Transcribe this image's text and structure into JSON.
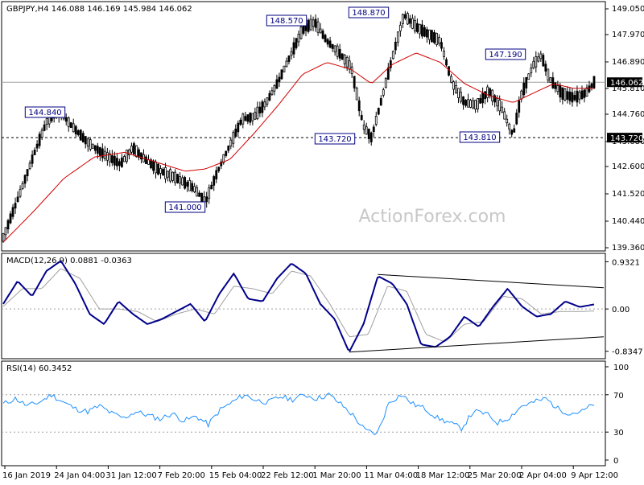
{
  "chart_data": [
    {
      "type": "candlestick",
      "header": "GBPJPY,H4  146.088 146.169 145.984 146.062",
      "symbol": "GBPJPY",
      "timeframe": "H4",
      "ohlc_readout": {
        "open": 146.088,
        "high": 146.169,
        "low": 145.984,
        "close": 146.062
      },
      "watermark": "ActionForex.com",
      "ylim": [
        139.0,
        149.4
      ],
      "y_ticks": [
        "149.050",
        "147.970",
        "146.890",
        "145.810",
        "144.760",
        "143.680",
        "142.600",
        "141.520",
        "140.440",
        "139.360"
      ],
      "current_price": "146.062",
      "support_level": {
        "value": 143.72,
        "label": "143.720"
      },
      "moving_average_color": "#d00000",
      "candle_color": "#000000",
      "price_path": [
        [
          0,
          139.5
        ],
        [
          8,
          141.3
        ],
        [
          16,
          143.2
        ],
        [
          22,
          144.5
        ],
        [
          28,
          144.8
        ],
        [
          34,
          144.2
        ],
        [
          42,
          143.5
        ],
        [
          50,
          143.0
        ],
        [
          58,
          142.6
        ],
        [
          64,
          143.3
        ],
        [
          70,
          142.8
        ],
        [
          78,
          142.3
        ],
        [
          86,
          142.0
        ],
        [
          94,
          141.6
        ],
        [
          100,
          141.0
        ],
        [
          106,
          142.3
        ],
        [
          112,
          143.4
        ],
        [
          118,
          144.5
        ],
        [
          124,
          144.6
        ],
        [
          130,
          145.2
        ],
        [
          136,
          146.1
        ],
        [
          142,
          147.2
        ],
        [
          148,
          148.3
        ],
        [
          154,
          148.6
        ],
        [
          160,
          147.8
        ],
        [
          166,
          147.3
        ],
        [
          172,
          146.7
        ],
        [
          178,
          144.2
        ],
        [
          182,
          143.72
        ],
        [
          186,
          145.0
        ],
        [
          192,
          147.0
        ],
        [
          198,
          148.9
        ],
        [
          204,
          148.4
        ],
        [
          210,
          148.1
        ],
        [
          216,
          147.8
        ],
        [
          222,
          146.0
        ],
        [
          228,
          145.2
        ],
        [
          234,
          145.1
        ],
        [
          240,
          145.7
        ],
        [
          246,
          145.0
        ],
        [
          252,
          143.81
        ],
        [
          256,
          145.5
        ],
        [
          262,
          146.8
        ],
        [
          266,
          147.19
        ],
        [
          270,
          146.2
        ],
        [
          276,
          145.6
        ],
        [
          282,
          145.4
        ],
        [
          288,
          145.6
        ],
        [
          292,
          146.06
        ]
      ],
      "ma_path": [
        [
          0,
          139.3
        ],
        [
          15,
          140.6
        ],
        [
          30,
          142.0
        ],
        [
          45,
          142.9
        ],
        [
          60,
          143.1
        ],
        [
          75,
          142.7
        ],
        [
          90,
          142.3
        ],
        [
          100,
          142.4
        ],
        [
          112,
          142.8
        ],
        [
          124,
          143.9
        ],
        [
          136,
          145.1
        ],
        [
          148,
          146.4
        ],
        [
          160,
          146.9
        ],
        [
          172,
          146.6
        ],
        [
          182,
          146.0
        ],
        [
          192,
          146.8
        ],
        [
          204,
          147.3
        ],
        [
          216,
          146.9
        ],
        [
          228,
          146.0
        ],
        [
          240,
          145.5
        ],
        [
          252,
          145.2
        ],
        [
          262,
          145.6
        ],
        [
          272,
          146.0
        ],
        [
          282,
          145.8
        ],
        [
          292,
          145.8
        ]
      ],
      "annotations": [
        {
          "text": "144.840",
          "value": 144.84
        },
        {
          "text": "141.000",
          "value": 141.0
        },
        {
          "text": "148.570",
          "value": 148.57
        },
        {
          "text": "143.720",
          "value": 143.72
        },
        {
          "text": "148.870",
          "value": 148.87
        },
        {
          "text": "143.810",
          "value": 143.81
        },
        {
          "text": "147.190",
          "value": 147.19
        }
      ]
    },
    {
      "type": "line",
      "header": "MACD(12,26,9) 0.0881 -0.0363",
      "indicator": "MACD(12,26,9)",
      "values_readout": {
        "macd": 0.0881,
        "signal": -0.0363
      },
      "ylim": [
        -0.95,
        1.05
      ],
      "y_ticks": [
        "0.9321",
        "0.00",
        "-0.8347"
      ],
      "macd_color": "#00008b",
      "signal_color": "#a0a0a0",
      "zero_line": 0.0,
      "macd_path": [
        [
          0,
          0.1
        ],
        [
          6,
          0.55
        ],
        [
          12,
          0.25
        ],
        [
          18,
          0.75
        ],
        [
          24,
          0.95
        ],
        [
          30,
          0.5
        ],
        [
          36,
          -0.1
        ],
        [
          42,
          -0.3
        ],
        [
          48,
          0.15
        ],
        [
          54,
          -0.1
        ],
        [
          60,
          -0.3
        ],
        [
          66,
          -0.2
        ],
        [
          72,
          -0.05
        ],
        [
          78,
          0.1
        ],
        [
          84,
          -0.25
        ],
        [
          90,
          0.3
        ],
        [
          96,
          0.7
        ],
        [
          102,
          0.2
        ],
        [
          108,
          0.15
        ],
        [
          114,
          0.6
        ],
        [
          120,
          0.9
        ],
        [
          126,
          0.7
        ],
        [
          132,
          0.1
        ],
        [
          138,
          -0.2
        ],
        [
          144,
          -0.85
        ],
        [
          150,
          -0.3
        ],
        [
          156,
          0.65
        ],
        [
          162,
          0.5
        ],
        [
          168,
          0.1
        ],
        [
          174,
          -0.7
        ],
        [
          180,
          -0.75
        ],
        [
          186,
          -0.55
        ],
        [
          192,
          -0.15
        ],
        [
          198,
          -0.35
        ],
        [
          204,
          0.05
        ],
        [
          210,
          0.4
        ],
        [
          216,
          0.05
        ],
        [
          222,
          -0.15
        ],
        [
          228,
          -0.1
        ],
        [
          234,
          0.15
        ],
        [
          240,
          0.04
        ],
        [
          246,
          0.09
        ]
      ],
      "signal_path": [
        [
          0,
          0.05
        ],
        [
          8,
          0.4
        ],
        [
          16,
          0.4
        ],
        [
          24,
          0.8
        ],
        [
          32,
          0.6
        ],
        [
          40,
          0.0
        ],
        [
          48,
          0.0
        ],
        [
          56,
          -0.05
        ],
        [
          64,
          -0.25
        ],
        [
          72,
          -0.1
        ],
        [
          80,
          0.0
        ],
        [
          88,
          -0.1
        ],
        [
          96,
          0.45
        ],
        [
          104,
          0.4
        ],
        [
          112,
          0.3
        ],
        [
          120,
          0.75
        ],
        [
          128,
          0.65
        ],
        [
          136,
          0.1
        ],
        [
          144,
          -0.55
        ],
        [
          152,
          -0.5
        ],
        [
          160,
          0.45
        ],
        [
          168,
          0.35
        ],
        [
          176,
          -0.5
        ],
        [
          184,
          -0.65
        ],
        [
          192,
          -0.3
        ],
        [
          200,
          -0.25
        ],
        [
          208,
          0.25
        ],
        [
          216,
          0.2
        ],
        [
          224,
          -0.1
        ],
        [
          232,
          -0.05
        ],
        [
          240,
          -0.05
        ],
        [
          246,
          -0.04
        ]
      ],
      "trend_lines": [
        {
          "from": [
            156,
            0.68
          ],
          "to": [
            246,
            0.42
          ]
        },
        {
          "from": [
            144,
            -0.85
          ],
          "to": [
            246,
            -0.55
          ]
        }
      ]
    },
    {
      "type": "line",
      "header": "RSI(14) 60.3452",
      "indicator": "RSI(14)",
      "value_readout": 60.3452,
      "ylim": [
        0,
        100
      ],
      "y_ticks": [
        "100",
        "70",
        "30",
        "0"
      ],
      "levels": [
        70,
        30
      ],
      "rsi_color": "#1e90ff",
      "rsi_path": [
        [
          0,
          60
        ],
        [
          6,
          66
        ],
        [
          12,
          58
        ],
        [
          18,
          62
        ],
        [
          24,
          70
        ],
        [
          30,
          62
        ],
        [
          36,
          55
        ],
        [
          42,
          52
        ],
        [
          48,
          58
        ],
        [
          54,
          50
        ],
        [
          60,
          45
        ],
        [
          66,
          52
        ],
        [
          72,
          48
        ],
        [
          78,
          44
        ],
        [
          84,
          50
        ],
        [
          90,
          42
        ],
        [
          96,
          47
        ],
        [
          102,
          38
        ],
        [
          108,
          54
        ],
        [
          114,
          62
        ],
        [
          120,
          70
        ],
        [
          126,
          64
        ],
        [
          132,
          62
        ],
        [
          138,
          68
        ],
        [
          144,
          65
        ],
        [
          150,
          70
        ],
        [
          156,
          66
        ],
        [
          162,
          70
        ],
        [
          168,
          60
        ],
        [
          174,
          48
        ],
        [
          180,
          32
        ],
        [
          186,
          28
        ],
        [
          192,
          62
        ],
        [
          198,
          70
        ],
        [
          204,
          60
        ],
        [
          210,
          55
        ],
        [
          216,
          45
        ],
        [
          222,
          40
        ],
        [
          228,
          34
        ],
        [
          234,
          52
        ],
        [
          240,
          50
        ],
        [
          246,
          40
        ],
        [
          252,
          46
        ],
        [
          258,
          58
        ],
        [
          264,
          62
        ],
        [
          270,
          66
        ],
        [
          276,
          55
        ],
        [
          282,
          50
        ],
        [
          288,
          52
        ],
        [
          294,
          60
        ]
      ]
    }
  ],
  "x_axis": {
    "labels": [
      "16 Jan 2019",
      "24 Jan 04:00",
      "31 Jan 12:00",
      "7 Feb 20:00",
      "15 Feb 04:00",
      "22 Feb 12:00",
      "1 Mar 20:00",
      "11 Mar 04:00",
      "18 Mar 12:00",
      "25 Mar 20:00",
      "2 Apr 04:00",
      "9 Apr 12:00"
    ]
  }
}
